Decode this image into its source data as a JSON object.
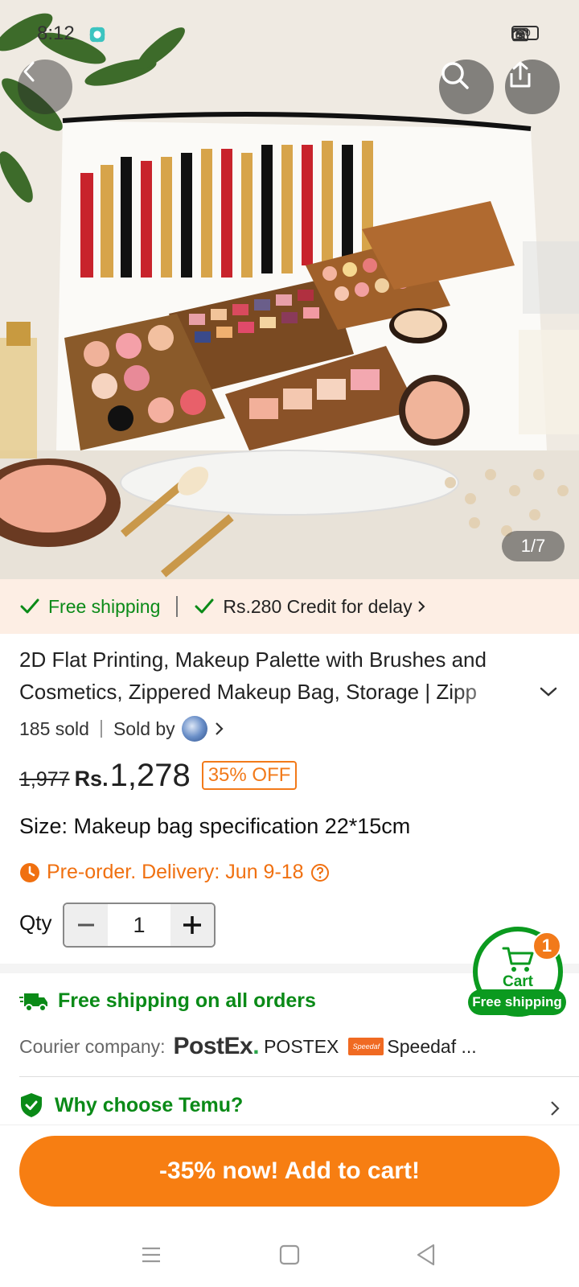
{
  "status_bar": {
    "time": "8:12",
    "battery": "70"
  },
  "hero": {
    "counter": "1/7"
  },
  "shipping_banner": {
    "free_shipping": "Free shipping",
    "credit": "Rs.280 Credit for delay"
  },
  "product": {
    "title": "2D Flat Printing, Makeup Palette with Brushes and Cosmetics, Zippered Makeup Bag, Storage | Zipp",
    "sold": "185 sold",
    "sold_by": "Sold by",
    "old_price": "1,977",
    "currency": "Rs.",
    "price": "1,278",
    "discount": "35% OFF",
    "size_label": "Size:",
    "size_value": "Makeup bag specification 22*15cm",
    "preorder": "Pre-order. Delivery: Jun 9-18",
    "qty_label": "Qty",
    "qty_value": "1"
  },
  "shipping_info": {
    "free_all": "Free shipping on all orders",
    "courier_label": "Courier company:",
    "postex_logo": "PostEx",
    "postex_dot": ".",
    "postex_name": "POSTEX",
    "speedaf_logo": "Speedaf",
    "speedaf_name": "Speedaf ..."
  },
  "why": {
    "label": "Why choose Temu?"
  },
  "cart": {
    "label": "Cart",
    "badge": "1",
    "free": "Free shipping"
  },
  "cta": {
    "label": "-35% now! Add to cart!"
  },
  "colors": {
    "accent_orange": "#f77e12",
    "green": "#0a8a17",
    "banner_bg": "#fdeee4"
  }
}
